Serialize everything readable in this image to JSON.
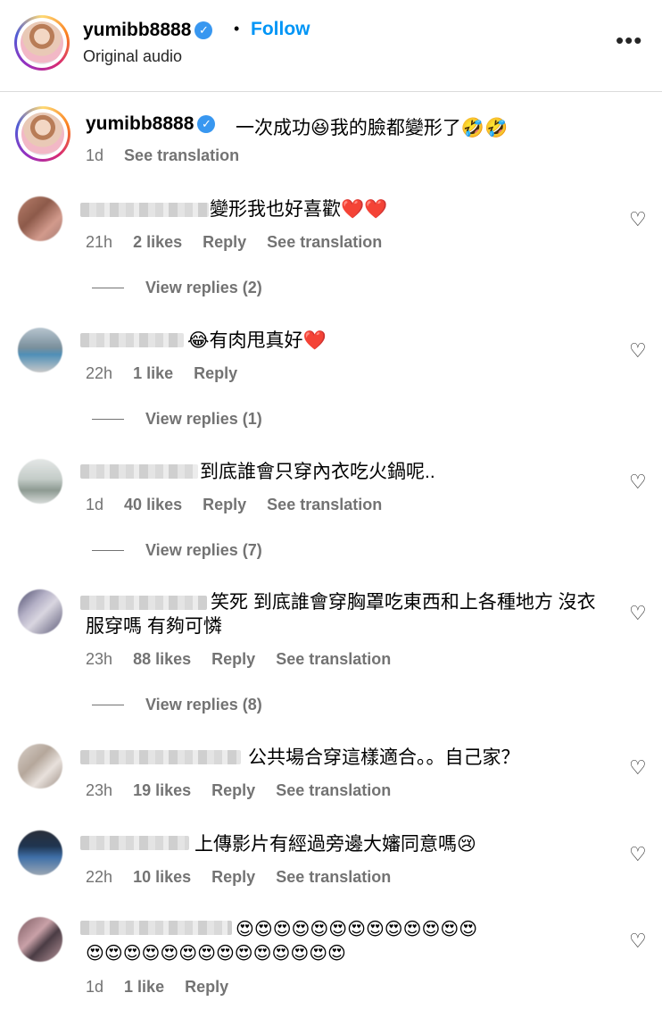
{
  "header": {
    "username": "yumibb8888",
    "verified_mark": "✓",
    "follow_label": "Follow",
    "audio": "Original audio",
    "more_icon": "•••"
  },
  "caption": {
    "username": "yumibb8888",
    "text": "一次成功😆我的臉都變形了🤣🤣",
    "time": "1d",
    "translate": "See translation"
  },
  "comments": [
    {
      "text": "變形我也好喜歡❤️❤️",
      "time": "21h",
      "likes": "2 likes",
      "reply": "Reply",
      "translate": "See translation",
      "view_replies": "View replies (2)"
    },
    {
      "text": "😂有肉甩真好❤️",
      "time": "22h",
      "likes": "1 like",
      "reply": "Reply",
      "view_replies": "View replies (1)"
    },
    {
      "text": "到底誰會只穿內衣吃火鍋呢..",
      "time": "1d",
      "likes": "40 likes",
      "reply": "Reply",
      "translate": "See translation",
      "view_replies": "View replies (7)"
    },
    {
      "text_line1": "笑死 到底誰會穿胸罩吃東西和上各種地方 沒衣",
      "text_line2": "服穿嗎 有夠可憐",
      "time": "23h",
      "likes": "88 likes",
      "reply": "Reply",
      "translate": "See translation",
      "view_replies": "View replies (8)"
    },
    {
      "text": "公共場合穿這樣適合。。自己家？",
      "time": "23h",
      "likes": "19 likes",
      "reply": "Reply",
      "translate": "See translation"
    },
    {
      "text": "上傳影片有經過旁邊大嬸同意嗎😢",
      "time": "22h",
      "likes": "10 likes",
      "reply": "Reply",
      "translate": "See translation"
    },
    {
      "text_line1": "😍😍😍😍😍😍😍😍😍😍😍😍😍",
      "text_line2": "😍😍😍😍😍😍😍😍😍😍😍😍😍😍",
      "time": "1d",
      "likes": "1 like",
      "reply": "Reply"
    }
  ],
  "icons": {
    "like": "heart-outline",
    "more": "more-horizontal",
    "verified": "verified-badge"
  },
  "colors": {
    "follow": "#0095f6",
    "meta": "#737373",
    "divider": "#dbdbdb"
  }
}
